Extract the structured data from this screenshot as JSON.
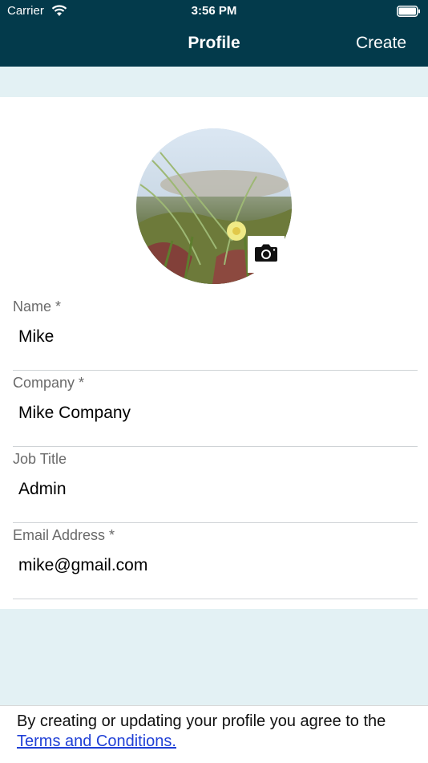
{
  "status_bar": {
    "carrier": "Carrier",
    "time": "3:56 PM"
  },
  "nav": {
    "title": "Profile",
    "create_label": "Create"
  },
  "fields": [
    {
      "label": "Name *",
      "value": "Mike"
    },
    {
      "label": "Company *",
      "value": "Mike Company"
    },
    {
      "label": "Job Title",
      "value": "Admin"
    },
    {
      "label": "Email Address *",
      "value": "mike@gmail.com"
    }
  ],
  "footer": {
    "text": "By creating or updating your profile you agree to the",
    "link": "Terms and Conditions."
  },
  "colors": {
    "header": "#033a4b",
    "background": "#e3f1f4",
    "link": "#1f3fd6"
  }
}
